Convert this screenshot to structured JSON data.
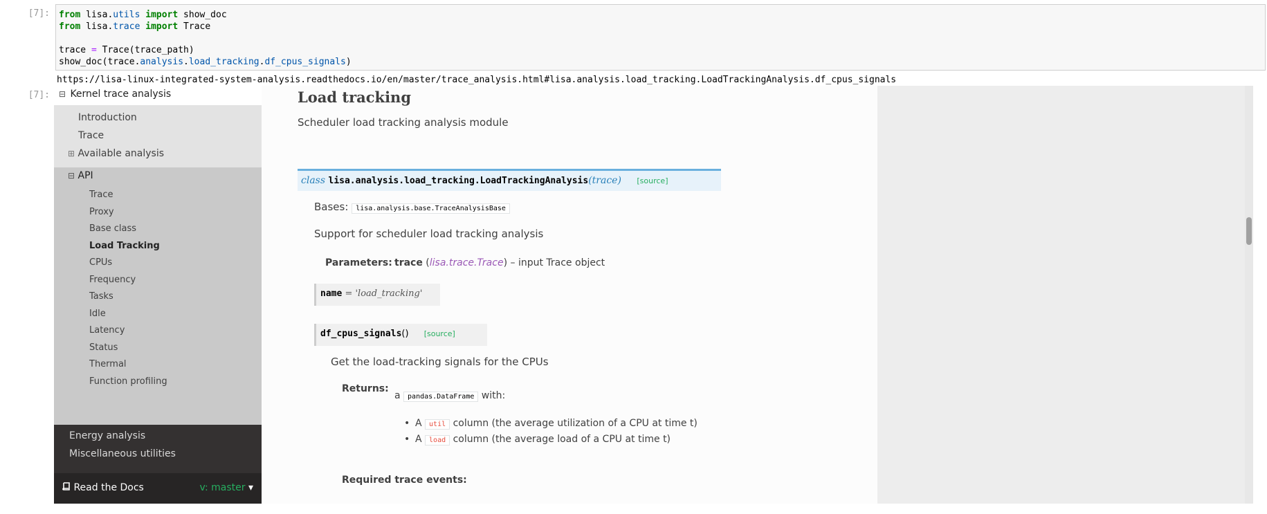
{
  "cells": {
    "in_prompt": "[7]:",
    "out_prompt": "[7]:",
    "code_lines": [
      {
        "parts": [
          {
            "t": "from",
            "c": "kw"
          },
          {
            "t": " lisa.",
            "c": ""
          },
          {
            "t": "utils",
            "c": "mod"
          },
          {
            "t": " ",
            "c": ""
          },
          {
            "t": "import",
            "c": "kw"
          },
          {
            "t": " show_doc",
            "c": ""
          }
        ]
      },
      {
        "parts": [
          {
            "t": "from",
            "c": "kw"
          },
          {
            "t": " lisa.",
            "c": ""
          },
          {
            "t": "trace",
            "c": "mod"
          },
          {
            "t": " ",
            "c": ""
          },
          {
            "t": "import",
            "c": "kw"
          },
          {
            "t": " Trace",
            "c": ""
          }
        ]
      },
      {
        "parts": [
          {
            "t": "",
            "c": ""
          }
        ]
      },
      {
        "parts": [
          {
            "t": "trace ",
            "c": ""
          },
          {
            "t": "=",
            "c": "op"
          },
          {
            "t": " Trace(trace_path)",
            "c": ""
          }
        ]
      },
      {
        "parts": [
          {
            "t": "show_doc(trace.",
            "c": ""
          },
          {
            "t": "analysis",
            "c": "mod"
          },
          {
            "t": ".",
            "c": ""
          },
          {
            "t": "load_tracking",
            "c": "mod"
          },
          {
            "t": ".",
            "c": ""
          },
          {
            "t": "df_cpus_signals",
            "c": "mod"
          },
          {
            "t": ")",
            "c": ""
          }
        ]
      }
    ],
    "output_url": "https://lisa-linux-integrated-system-analysis.readthedocs.io/en/master/trace_analysis.html#lisa.analysis.load_tracking.LoadTrackingAnalysis.df_cpus_signals"
  },
  "sidebar": {
    "title": "Kernel trace analysis",
    "title_toggle": "⊟",
    "top_items": [
      "Introduction",
      "Trace"
    ],
    "available": {
      "toggle": "⊞",
      "label": "Available analysis"
    },
    "api": {
      "toggle": "⊟",
      "label": "API"
    },
    "api_items": [
      "Trace",
      "Proxy",
      "Base class",
      "Load Tracking",
      "CPUs",
      "Frequency",
      "Tasks",
      "Idle",
      "Latency",
      "Status",
      "Thermal",
      "Function profiling"
    ],
    "api_current": "Load Tracking",
    "bottom_items": [
      "Energy analysis",
      "Miscellaneous utilities"
    ],
    "rtd": {
      "icon": "book-icon",
      "brand": "Read the Docs",
      "version": "v: master",
      "caret": "▾"
    }
  },
  "doc": {
    "title": "Load tracking",
    "module_desc": "Scheduler load tracking analysis module",
    "class_sig": {
      "kind": "class",
      "name": "lisa.analysis.load_tracking.LoadTrackingAnalysis",
      "open": "(",
      "param": "trace",
      "close": ")",
      "source": "[source]"
    },
    "bases_label": "Bases:",
    "bases_value": "lisa.analysis.base.TraceAnalysisBase",
    "class_desc": "Support for scheduler load tracking analysis",
    "params_label": "Parameters:",
    "param_name": "trace",
    "param_open": " (",
    "param_type": "lisa.trace.Trace",
    "param_close": ")",
    "param_desc": " – input Trace object",
    "attr_sig": {
      "name": "name",
      "eq": " = ",
      "value": "'load_tracking'"
    },
    "method_sig": {
      "name": "df_cpus_signals",
      "parens": "()",
      "source": "[source]"
    },
    "method_desc": "Get the load-tracking signals for the CPUs",
    "returns_label": "Returns:",
    "returns_a": "a ",
    "returns_type": "pandas.DataFrame",
    "returns_with": " with:",
    "bullets": [
      {
        "pre": "A ",
        "code": "util",
        "post": " column (the average utilization of a CPU at time t)"
      },
      {
        "pre": "A ",
        "code": "load",
        "post": " column (the average load of a CPU at time t)"
      }
    ],
    "required_label": "Required trace events:"
  }
}
